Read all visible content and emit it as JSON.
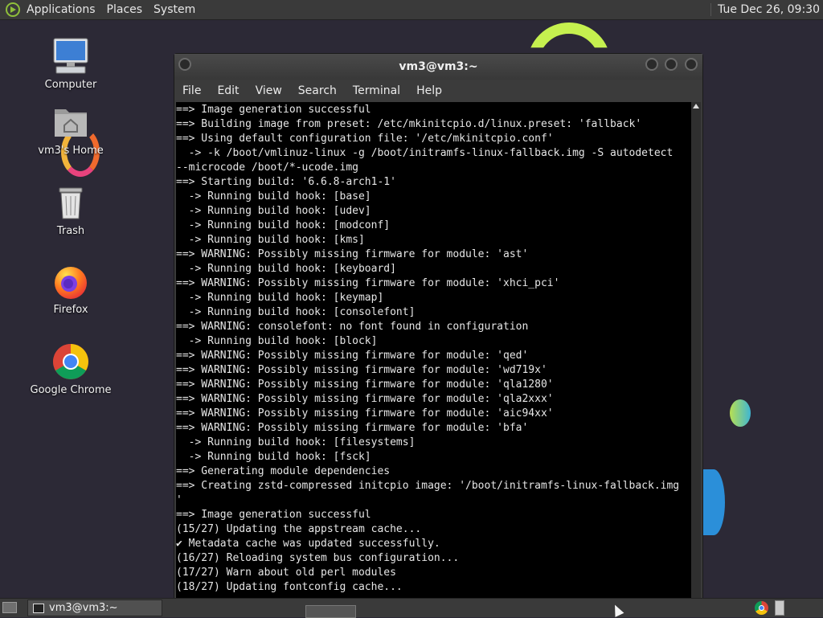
{
  "top_panel": {
    "menus": [
      "Applications",
      "Places",
      "System"
    ],
    "clock": "Tue Dec 26, 09:30"
  },
  "desktop": {
    "icons": [
      {
        "label": "Computer",
        "icon": "computer-icon"
      },
      {
        "label": "vm3's Home",
        "icon": "home-folder-icon"
      },
      {
        "label": "Trash",
        "icon": "trash-icon"
      },
      {
        "label": "Firefox",
        "icon": "firefox-icon"
      },
      {
        "label": "Google Chrome",
        "icon": "chrome-icon"
      }
    ]
  },
  "window": {
    "title": "vm3@vm3:~",
    "menu": [
      "File",
      "Edit",
      "View",
      "Search",
      "Terminal",
      "Help"
    ],
    "terminal_lines": [
      "==> Image generation successful",
      "==> Building image from preset: /etc/mkinitcpio.d/linux.preset: 'fallback'",
      "==> Using default configuration file: '/etc/mkinitcpio.conf'",
      "  -> -k /boot/vmlinuz-linux -g /boot/initramfs-linux-fallback.img -S autodetect",
      "--microcode /boot/*-ucode.img",
      "==> Starting build: '6.6.8-arch1-1'",
      "  -> Running build hook: [base]",
      "  -> Running build hook: [udev]",
      "  -> Running build hook: [modconf]",
      "  -> Running build hook: [kms]",
      "==> WARNING: Possibly missing firmware for module: 'ast'",
      "  -> Running build hook: [keyboard]",
      "==> WARNING: Possibly missing firmware for module: 'xhci_pci'",
      "  -> Running build hook: [keymap]",
      "  -> Running build hook: [consolefont]",
      "==> WARNING: consolefont: no font found in configuration",
      "  -> Running build hook: [block]",
      "==> WARNING: Possibly missing firmware for module: 'qed'",
      "==> WARNING: Possibly missing firmware for module: 'wd719x'",
      "==> WARNING: Possibly missing firmware for module: 'qla1280'",
      "==> WARNING: Possibly missing firmware for module: 'qla2xxx'",
      "==> WARNING: Possibly missing firmware for module: 'aic94xx'",
      "==> WARNING: Possibly missing firmware for module: 'bfa'",
      "  -> Running build hook: [filesystems]",
      "  -> Running build hook: [fsck]",
      "==> Generating module dependencies",
      "==> Creating zstd-compressed initcpio image: '/boot/initramfs-linux-fallback.img",
      "'",
      "==> Image generation successful",
      "(15/27) Updating the appstream cache...",
      "✔ Metadata cache was updated successfully.",
      "(16/27) Reloading system bus configuration...",
      "(17/27) Warn about old perl modules",
      "(18/27) Updating fontconfig cache..."
    ]
  },
  "taskbar": {
    "task_label": "vm3@vm3:~"
  }
}
